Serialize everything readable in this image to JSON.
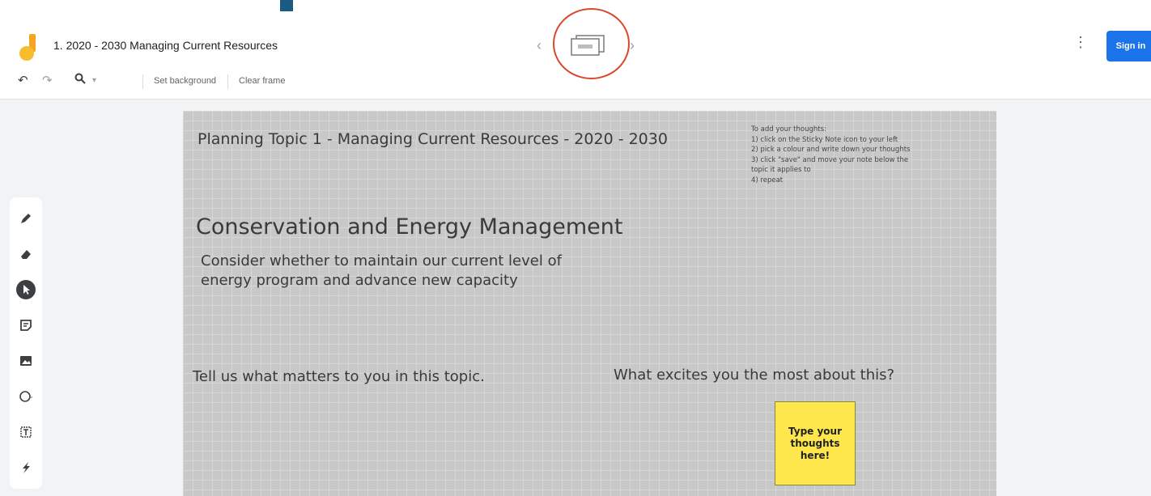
{
  "header": {
    "document_title": "1. 2020 - 2030 Managing Current Resources",
    "prev_frame_icon": "chevron-left-icon",
    "next_frame_icon": "chevron-right-icon",
    "more_icon": "more-vert-icon",
    "sign_in_label": "Sign in",
    "accent_color": "#1a73e8",
    "highlight_color": "#d9482b"
  },
  "toolbar": {
    "undo_icon": "undo-icon",
    "redo_icon": "redo-icon",
    "zoom_icon": "zoom-icon",
    "set_background_label": "Set background",
    "clear_frame_label": "Clear frame"
  },
  "side_tools": [
    {
      "name": "pen-icon"
    },
    {
      "name": "eraser-icon"
    },
    {
      "name": "select-icon",
      "active": true
    },
    {
      "name": "sticky-note-icon"
    },
    {
      "name": "image-icon"
    },
    {
      "name": "circle-icon"
    },
    {
      "name": "text-box-icon"
    },
    {
      "name": "laser-icon"
    }
  ],
  "canvas": {
    "planning_title": "Planning Topic 1 - Managing Current Resources - 2020 - 2030",
    "instructions": "To add your thoughts:\n1) click on the Sticky Note icon to your left\n2) pick a colour and write down your thoughts\n3) click \"save\" and move your note below the\ntopic it applies to\n4) repeat",
    "topic_heading": "Conservation and Energy Management",
    "topic_description": "Consider whether to maintain our current level of\nenergy program and advance new capacity",
    "prompt_left": "Tell us what matters to you in this topic.",
    "prompt_right": "What excites you the most about this?",
    "sticky_note_text": "Type your\nthoughts\nhere!",
    "sticky_color": "#fde74c"
  }
}
